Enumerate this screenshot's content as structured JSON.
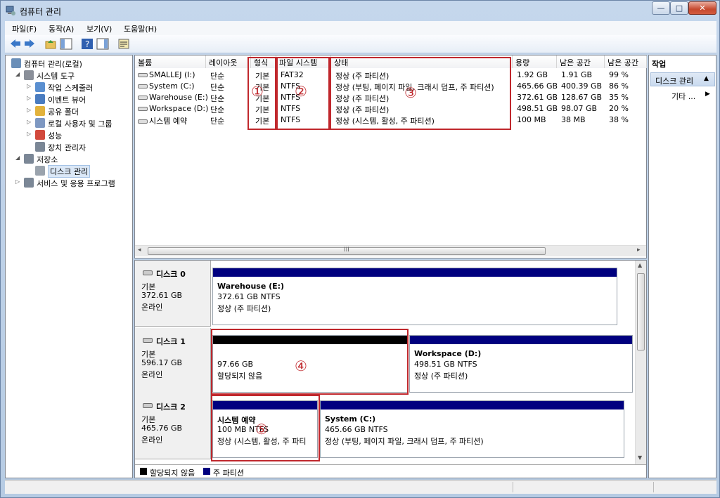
{
  "window": {
    "title": "컴퓨터 관리",
    "minimize": "—",
    "maximize": "□",
    "close": "✕"
  },
  "menu": [
    "파일(F)",
    "동작(A)",
    "보기(V)",
    "도움말(H)"
  ],
  "tree": [
    {
      "label": "컴퓨터 관리(로컬)",
      "expander": "",
      "icon": "computer-management-icon",
      "color": "#6b8fb8",
      "level": 0
    },
    {
      "label": "시스템 도구",
      "expander": "◢",
      "icon": "system-tools-icon",
      "color": "#8a8f99",
      "level": 1
    },
    {
      "label": "작업 스케줄러",
      "expander": "▷",
      "icon": "task-scheduler-icon",
      "color": "#5a8fd0",
      "level": 2
    },
    {
      "label": "이벤트 뷰어",
      "expander": "▷",
      "icon": "event-viewer-icon",
      "color": "#4a7cc0",
      "level": 2
    },
    {
      "label": "공유 폴더",
      "expander": "▷",
      "icon": "shared-folders-icon",
      "color": "#e2b23c",
      "level": 2
    },
    {
      "label": "로컬 사용자 및 그룹",
      "expander": "▷",
      "icon": "local-users-icon",
      "color": "#7e98c2",
      "level": 2
    },
    {
      "label": "성능",
      "expander": "▷",
      "icon": "performance-icon",
      "color": "#d2493c",
      "level": 2
    },
    {
      "label": "장치 관리자",
      "expander": "",
      "icon": "device-manager-icon",
      "color": "#7b8796",
      "level": 2
    },
    {
      "label": "저장소",
      "expander": "◢",
      "icon": "storage-icon",
      "color": "#7b8796",
      "level": 1
    },
    {
      "label": "디스크 관리",
      "expander": "",
      "icon": "disk-management-icon",
      "color": "#9aa3ad",
      "level": 2,
      "selected": true
    },
    {
      "label": "서비스 및 응용 프로그램",
      "expander": "▷",
      "icon": "services-icon",
      "color": "#7b8796",
      "level": 1
    }
  ],
  "volume_headers": [
    "볼륨",
    "레이아웃",
    "형식",
    "파일 시스템",
    "상태",
    "용량",
    "남은 공간",
    "남은 공간"
  ],
  "volumes": [
    {
      "name": "SMALLEJ (I:)",
      "layout": "단순",
      "type": "기본",
      "fs": "FAT32",
      "status": "정상 (주 파티션)",
      "capacity": "1.92 GB",
      "free": "1.91 GB",
      "pct": "99 %"
    },
    {
      "name": "System (C:)",
      "layout": "단순",
      "type": "기본",
      "fs": "NTFS",
      "status": "정상 (부팅, 페이지 파일, 크래시 덤프, 주 파티션)",
      "capacity": "465.66 GB",
      "free": "400.39 GB",
      "pct": "86 %"
    },
    {
      "name": "Warehouse (E:)",
      "layout": "단순",
      "type": "기본",
      "fs": "NTFS",
      "status": "정상 (주 파티션)",
      "capacity": "372.61 GB",
      "free": "128.67 GB",
      "pct": "35 %"
    },
    {
      "name": "Workspace (D:)",
      "layout": "단순",
      "type": "기본",
      "fs": "NTFS",
      "status": "정상 (주 파티션)",
      "capacity": "498.51 GB",
      "free": "98.07 GB",
      "pct": "20 %"
    },
    {
      "name": "시스템 예약",
      "layout": "단순",
      "type": "기본",
      "fs": "NTFS",
      "status": "정상 (시스템, 활성, 주 파티션)",
      "capacity": "100 MB",
      "free": "38 MB",
      "pct": "38 %"
    }
  ],
  "annotations": [
    "①",
    "②",
    "③",
    "④",
    "⑤"
  ],
  "disks": [
    {
      "name": "디스크 0",
      "type": "기본",
      "size": "372.61 GB",
      "state": "온라인",
      "partitions": [
        {
          "title": "Warehouse  (E:)",
          "line2": "372.61 GB NTFS",
          "line3": "정상 (주 파티션)"
        }
      ]
    },
    {
      "name": "디스크 1",
      "type": "기본",
      "size": "596.17 GB",
      "state": "온라인",
      "partitions": [
        {
          "title": "",
          "line2": "97.66 GB",
          "line3": "할당되지 않음"
        },
        {
          "title": "Workspace  (D:)",
          "line2": "498.51 GB NTFS",
          "line3": "정상 (주 파티션)"
        }
      ]
    },
    {
      "name": "디스크 2",
      "type": "기본",
      "size": "465.76 GB",
      "state": "온라인",
      "partitions": [
        {
          "title": "시스템 예약",
          "line2": "100 MB NTFS",
          "line3": "정상 (시스템, 활성, 주 파티"
        },
        {
          "title": "System  (C:)",
          "line2": "465.66 GB NTFS",
          "line3": "정상 (부팅, 페이지 파일, 크래시 덤프, 주 파티션)"
        }
      ]
    }
  ],
  "legend": {
    "unallocated": "할당되지 않음",
    "primary": "주 파티션"
  },
  "colors": {
    "primary_bar": "#00007f",
    "unallocated_bar": "#000000",
    "annotation": "#c0282d"
  },
  "hscroll_grip": "III",
  "actions": {
    "title": "작업",
    "section": "디스크 관리",
    "more": "기타 ..."
  }
}
